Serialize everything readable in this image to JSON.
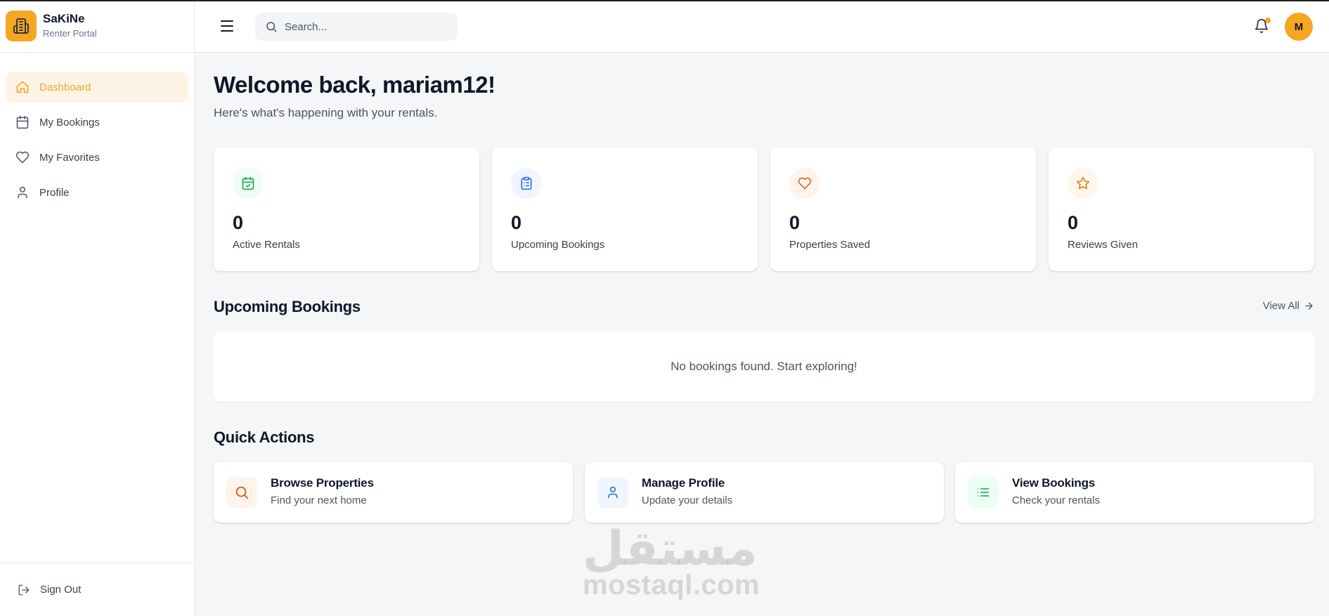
{
  "brand": {
    "name": "SaKiNe",
    "subtitle": "Renter Portal",
    "icon": "building-icon",
    "accent": "#f5a623"
  },
  "sidebar": {
    "items": [
      {
        "label": "Dashboard",
        "icon": "home-icon",
        "active": true
      },
      {
        "label": "My Bookings",
        "icon": "calendar-icon",
        "active": false
      },
      {
        "label": "My Favorites",
        "icon": "heart-icon",
        "active": false
      },
      {
        "label": "Profile",
        "icon": "user-icon",
        "active": false
      }
    ],
    "signout_label": "Sign Out",
    "signout_icon": "logout-icon"
  },
  "header": {
    "menu_icon": "menu-icon",
    "search": {
      "placeholder": "Search...",
      "value": ""
    },
    "notification_icon": "bell-icon",
    "has_notification": true,
    "avatar_initial": "M"
  },
  "welcome": {
    "title": "Welcome back, mariam12!",
    "subtitle": "Here's what's happening with your rentals."
  },
  "stats": [
    {
      "value": "0",
      "label": "Active Rentals",
      "icon": "calendar-check-icon",
      "color": "#16a34a",
      "bg": "#ecfdf3"
    },
    {
      "value": "0",
      "label": "Upcoming Bookings",
      "icon": "clipboard-list-icon",
      "color": "#2563eb",
      "bg": "#eff6ff"
    },
    {
      "value": "0",
      "label": "Properties Saved",
      "icon": "heart-icon",
      "color": "#ea580c",
      "bg": "#fff4ec"
    },
    {
      "value": "0",
      "label": "Reviews Given",
      "icon": "star-icon",
      "color": "#d97706",
      "bg": "#fff7ec"
    }
  ],
  "upcoming": {
    "title": "Upcoming Bookings",
    "view_all": "View All",
    "empty_text": "No bookings found. Start exploring!"
  },
  "quick_actions": {
    "title": "Quick Actions",
    "items": [
      {
        "title": "Browse Properties",
        "subtitle": "Find your next home",
        "icon": "search-icon",
        "color": "#ea580c",
        "bg": "#fff4ec"
      },
      {
        "title": "Manage Profile",
        "subtitle": "Update your details",
        "icon": "user-icon",
        "color": "#2563eb",
        "bg": "#eff6ff"
      },
      {
        "title": "View Bookings",
        "subtitle": "Check your rentals",
        "icon": "list-icon",
        "color": "#16a34a",
        "bg": "#ecfdf3"
      }
    ]
  },
  "watermark": {
    "arabic": "مستقل",
    "latin": "mostaql.com"
  }
}
